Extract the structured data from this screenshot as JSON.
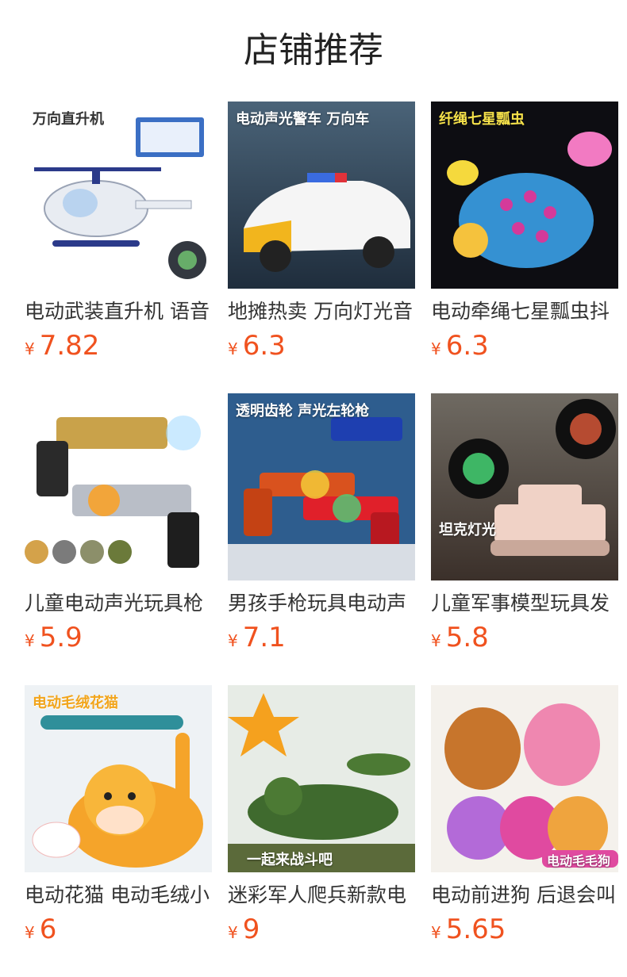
{
  "header": {
    "title": "店铺推荐"
  },
  "currency_symbol": "¥",
  "colors": {
    "price": "#f0521f",
    "title": "#222222",
    "name": "#333333"
  },
  "products": [
    {
      "name": "电动武装直升机 语音",
      "price": "7.82",
      "image_icon": "helicopter-toy-icon",
      "image_caption": "万向直升机"
    },
    {
      "name": "地摊热卖 万向灯光音",
      "price": "6.3",
      "image_icon": "police-car-toy-icon",
      "image_caption": "电动声光警车 万向车"
    },
    {
      "name": "电动牵绳七星瓢虫抖",
      "price": "6.3",
      "image_icon": "ladybug-toy-icon",
      "image_caption": "纤绳七星瓢虫"
    },
    {
      "name": "儿童电动声光玩具枪",
      "price": "5.9",
      "image_icon": "toy-gun-icon",
      "image_caption": ""
    },
    {
      "name": "男孩手枪玩具电动声",
      "price": "7.1",
      "image_icon": "gear-revolver-icon",
      "image_caption": "透明齿轮 声光左轮枪"
    },
    {
      "name": "儿童军事模型玩具发",
      "price": "5.8",
      "image_icon": "tank-toy-icon",
      "image_caption": "坦克灯光"
    },
    {
      "name": "电动花猫 电动毛绒小",
      "price": "6",
      "image_icon": "plush-cat-icon",
      "image_caption": "电动毛绒花猫"
    },
    {
      "name": "迷彩军人爬兵新款电",
      "price": "9",
      "image_icon": "crawling-soldier-icon",
      "image_caption": "一起来战斗吧"
    },
    {
      "name": "电动前进狗 后退会叫",
      "price": "5.65",
      "image_icon": "plush-dog-icon",
      "image_caption": "电动毛毛狗"
    }
  ]
}
